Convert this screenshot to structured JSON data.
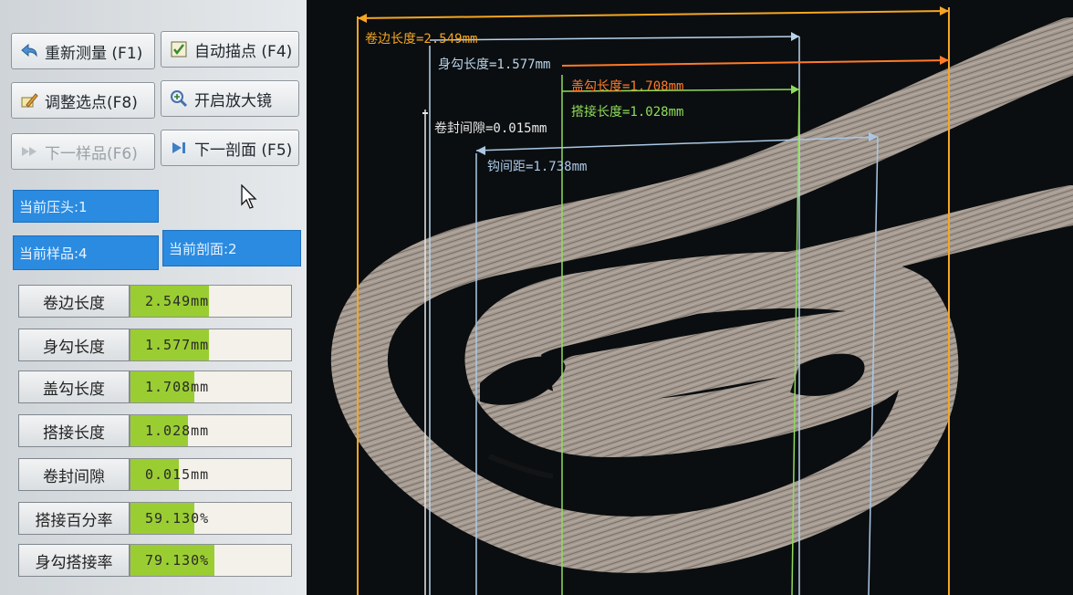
{
  "toolbar": {
    "remeasure": "重新测量 (F1)",
    "auto_point": "自动描点 (F4)",
    "adjust_points": "调整选点(F8)",
    "open_magnifier": "开启放大镜",
    "next_sample": "下一样品(F6)",
    "next_section": "下一剖面 (F5)"
  },
  "status": {
    "current_head": "当前压头:1",
    "current_sample": "当前样品:4",
    "current_section": "当前剖面:2"
  },
  "metrics": [
    {
      "label": "卷边长度",
      "value": "2.549mm",
      "fill": 0.49
    },
    {
      "label": "身勾长度",
      "value": "1.577mm",
      "fill": 0.49
    },
    {
      "label": "盖勾长度",
      "value": "1.708mm",
      "fill": 0.4
    },
    {
      "label": "搭接长度",
      "value": "1.028mm",
      "fill": 0.36
    },
    {
      "label": "卷封间隙",
      "value": "0.015mm",
      "fill": 0.3
    },
    {
      "label": "搭接百分率",
      "value": "59.130%",
      "fill": 0.4
    },
    {
      "label": "身勾搭接率",
      "value": "79.130%",
      "fill": 0.52
    }
  ],
  "annotations": {
    "seam_length": "卷边长度=2.549mm",
    "body_hook": "身勾长度=1.577mm",
    "cover_hook": "盖勾长度=1.708mm",
    "overlap": "搭接长度=1.028mm",
    "seam_gap": "卷封间隙=0.015mm",
    "hook_spacing": "钩间距=1.738mm"
  },
  "colors": {
    "seam_length": "#f5a623",
    "body_hook": "#b8d4ec",
    "cover_hook": "#ff7a29",
    "overlap": "#8fdc5a",
    "seam_gap": "#e8e8e8",
    "hook_spacing": "#aac8e6",
    "fill": "#9acd32",
    "status_blue": "#2a8be0"
  }
}
